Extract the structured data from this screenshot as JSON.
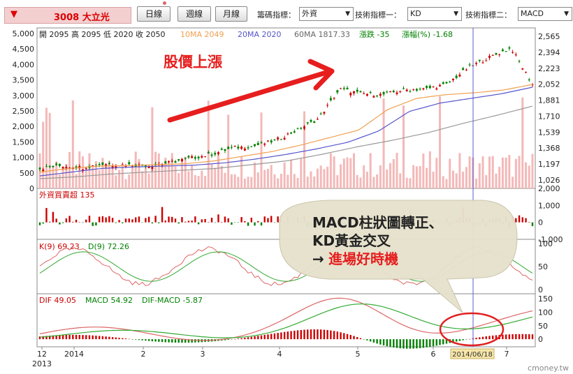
{
  "toolbar": {
    "arrow": "▼",
    "stock": "3008 大立光",
    "buttons": [
      "日線",
      "週線",
      "月線"
    ],
    "chip_label": "籌碼指標：",
    "chip_value": "外資",
    "tech1_label": "技術指標一：",
    "tech1_value": "KD",
    "tech2_label": "技術指標二：",
    "tech2_value": "MACD"
  },
  "colors": {
    "up": "#cc0000",
    "down": "#008000",
    "ma10": "#f0a050",
    "ma20": "#5555cc",
    "ma60": "#999999",
    "vol": "#f4b8b8",
    "callout_bg": "#e6e2cc",
    "arrow": "#e61e1e"
  },
  "chart_data": [
    {
      "type": "line",
      "panel": "price",
      "info": {
        "ohlc": "開 2095 高 2095 低 2020 收 2050",
        "ma10": "10MA 2049",
        "ma20": "20MA 2020",
        "ma60": "60MA 1817.33",
        "change": "漲跌 -35",
        "pct": "漲幅(%) -1.68"
      },
      "annotation": "股價上漲",
      "left_ticks": [
        "5,000",
        "4,500",
        "4,000",
        "3,500",
        "3,000",
        "2,500",
        "2,000",
        "1,500",
        "1,000",
        "500",
        "0"
      ],
      "right_ticks": [
        "2,565",
        "2,394",
        "2,223",
        "2,052",
        "1,881",
        "1,710",
        "1,539",
        "1,368",
        "1,197",
        "1,026"
      ],
      "ylim_price": [
        1026,
        2565
      ],
      "ylim_volume": [
        0,
        5000
      ],
      "anchors_close": [
        1150,
        1180,
        1160,
        1200,
        1190,
        1180,
        1210,
        1260,
        1300,
        1370,
        1390,
        1450,
        1560,
        1680,
        2000,
        1950,
        1940,
        1990,
        2000,
        2050,
        2230,
        2340,
        2440,
        2050
      ],
      "ma10_anchors": [
        1110,
        1150,
        1175,
        1180,
        1190,
        1200,
        1230,
        1280,
        1330,
        1400,
        1480,
        1560,
        1780,
        1900,
        1940,
        1960,
        1990,
        2049
      ],
      "ma20_anchors": [
        1070,
        1110,
        1150,
        1165,
        1175,
        1185,
        1210,
        1250,
        1300,
        1360,
        1430,
        1550,
        1760,
        1850,
        1900,
        1950,
        2020
      ],
      "ma60_anchors": [
        1040,
        1060,
        1090,
        1110,
        1130,
        1150,
        1190,
        1230,
        1300,
        1380,
        1450,
        1530,
        1630,
        1720,
        1817.33
      ]
    },
    {
      "type": "bar",
      "panel": "foreign",
      "label": "外資買賣超 135",
      "ticks": [
        "2,000",
        "1,000",
        "0",
        "-1,000"
      ],
      "ylim": [
        -1000,
        2000
      ]
    },
    {
      "type": "line",
      "panel": "kd",
      "k_label": "K(9) 69.23",
      "d_label": "D(9) 72.26",
      "ticks": [
        "100",
        "50",
        "0"
      ],
      "ylim": [
        0,
        100
      ]
    },
    {
      "type": "line",
      "panel": "macd",
      "dif_label": "DIF 49.05",
      "macd_label": "MACD 54.92",
      "osc_label": "DIF-MACD -5.87",
      "ticks": [
        "150",
        "100",
        "50",
        "0"
      ],
      "ylim": [
        -10,
        150
      ]
    }
  ],
  "x_axis": {
    "labels": [
      "12",
      "2014",
      "2",
      "3",
      "4",
      "5",
      "6",
      "7"
    ],
    "year_label": "2013",
    "highlight_date": "2014/06/18"
  },
  "callout": {
    "line1": "MACD柱狀圖轉正、",
    "line2": "KD黃金交叉",
    "line3_prefix": "→",
    "line3": "進場好時機"
  },
  "watermark": "cmoney.tw"
}
